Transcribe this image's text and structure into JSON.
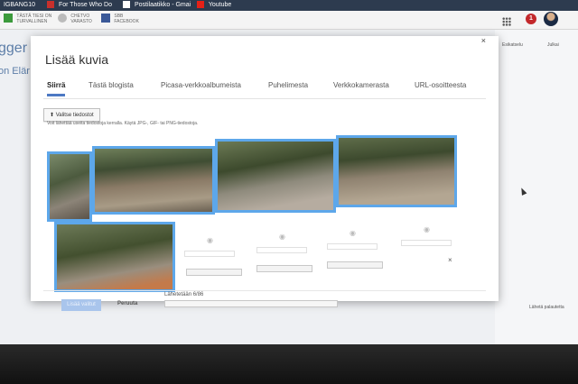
{
  "browser_tabs": [
    {
      "label": "IGBANG10"
    },
    {
      "label": "For Those Who Do"
    },
    {
      "label": "Postilaatikko - Gmai"
    },
    {
      "label": "Youtube"
    }
  ],
  "bookmarks": [
    {
      "label": "TÄSTÄ TIESI ON\nTURVALLINEN"
    },
    {
      "label": "CHETVO\nVARASTO"
    },
    {
      "label": "SBB\nFACEBOOK"
    }
  ],
  "bg": {
    "partial_title": "gger",
    "partial_sub": "on Elär"
  },
  "toolbar": {
    "notifications": "1",
    "preview_label": "Esikatselu",
    "publish_label": "Julkai",
    "feedback_label": "Lähetä palautetta"
  },
  "dialog": {
    "title": "Lisää kuvia",
    "close": "×",
    "tabs": [
      {
        "label": "Siirrä",
        "active": true
      },
      {
        "label": "Tästä blogista"
      },
      {
        "label": "Picasa-verkkoalbumeista"
      },
      {
        "label": "Puhelimesta"
      },
      {
        "label": "Verkkokamerasta"
      },
      {
        "label": "URL-osoitteesta"
      }
    ],
    "choose_files": "Valitse tiedostot",
    "hint": "Voit lähettää useita tiedostoja kerralla. Käytä JPG-, GIF- tai PNG-tiedostoja.",
    "remove": "×",
    "add_button": "Lisää valitut",
    "cancel_button": "Peruuta",
    "status": "Lähetetään 6/86"
  },
  "colors": {
    "selection_border": "#5da7ea",
    "tab_underline": "#4d79c3",
    "add_button_bg": "#a9c5ec",
    "tab_bar": "#2d3b4f"
  },
  "icons": [
    "upload-icon",
    "camera-icon",
    "close-icon",
    "apps-grid-icon",
    "notification-icon",
    "avatar",
    "cursor-icon"
  ]
}
